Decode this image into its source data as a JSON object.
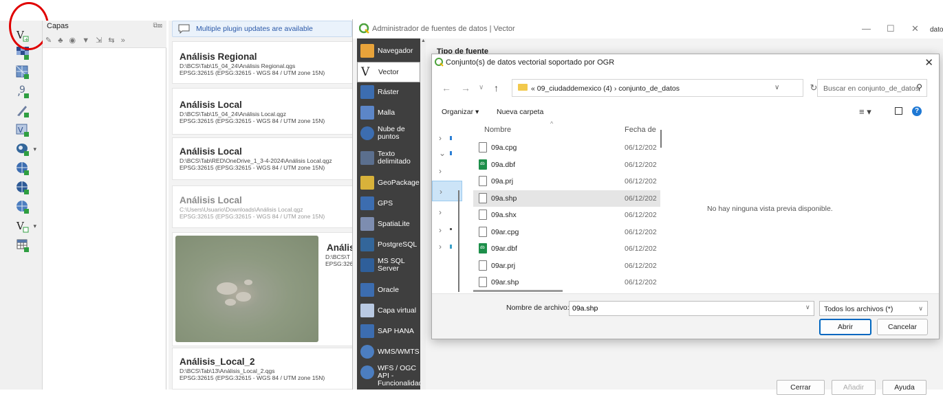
{
  "layers_panel": {
    "title": "Capas",
    "toolbar_glyphs": "✎ ♣ ◉ ▼ ⇲ ⇆ »"
  },
  "welcome": {
    "plugin_updates": "Multiple plugin updates are available",
    "projects": [
      {
        "title": "Análisis Regional",
        "path": "D:\\BCS\\Tab\\15_04_24\\Análisis Regional.qgs",
        "crs": "EPSG:32615 (EPSG:32615 - WGS 84 / UTM zone 15N)"
      },
      {
        "title": "Análisis Local",
        "path": "D:\\BCS\\Tab\\15_04_24\\Análisis Local.qgz",
        "crs": "EPSG:32615 (EPSG:32615 - WGS 84 / UTM zone 15N)"
      },
      {
        "title": "Análisis Local",
        "path": "D:\\BCS\\Tab\\RED\\OneDrive_1_3-4-2024\\Análisis Local.qgz",
        "crs": "EPSG:32615 (EPSG:32615 - WGS 84 / UTM zone 15N)"
      },
      {
        "title": "Análisis Local",
        "path": "C:\\Users\\Usuario\\Downloads\\Análisis Local.qgz",
        "crs": "EPSG:32615 (EPSG:32615 - WGS 84 / UTM zone 15N)"
      },
      {
        "title": "Análisi",
        "path": "D:\\BCS\\T",
        "crs": "EPSG:326"
      },
      {
        "title": "Análisis_Local_2",
        "path": "D:\\BCS\\Tab\\13\\Análisis_Local_2.qgs",
        "crs": "EPSG:32615 (EPSG:32615 - WGS 84 / UTM zone 15N)"
      }
    ]
  },
  "source_manager": {
    "title": "Administrador de fuentes de datos | Vector",
    "section_label": "Tipo de fuente",
    "nav": [
      {
        "label": "Navegador",
        "icon": "folder-icon"
      },
      {
        "label": "Vector",
        "icon": "vector-icon"
      },
      {
        "label": "Ráster",
        "icon": "raster-icon"
      },
      {
        "label": "Malla",
        "icon": "mesh-icon"
      },
      {
        "label": "Nube de puntos",
        "icon": "point-cloud-icon"
      },
      {
        "label": "Texto delimitado",
        "icon": "delimited-text-icon"
      },
      {
        "label": "GeoPackage",
        "icon": "geopackage-icon"
      },
      {
        "label": "GPS",
        "icon": "gps-icon"
      },
      {
        "label": "SpatiaLite",
        "icon": "spatialite-icon"
      },
      {
        "label": "PostgreSQL",
        "icon": "postgresql-icon"
      },
      {
        "label": "MS SQL Server",
        "icon": "mssql-icon"
      },
      {
        "label": "Oracle",
        "icon": "oracle-icon"
      },
      {
        "label": "Capa virtual",
        "icon": "virtual-layer-icon"
      },
      {
        "label": "SAP HANA",
        "icon": "sap-hana-icon"
      },
      {
        "label": "WMS/WMTS",
        "icon": "wms-icon"
      },
      {
        "label": "WFS / OGC API - Funcionalidad",
        "icon": "wfs-icon"
      }
    ],
    "buttons": {
      "close": "Cerrar",
      "add": "Añadir",
      "help": "Ayuda"
    },
    "minimize": "—",
    "maximize": "☐",
    "close_glyph": "✕"
  },
  "file_dialog": {
    "title": "Conjunto(s) de datos vectorial soportado por OGR",
    "breadcrumb": "« 09_ciudaddemexico (4)  ›  conjunto_de_datos",
    "search_placeholder": "Buscar en conjunto_de_datos",
    "organize": "Organizar ▾",
    "new_folder": "Nueva carpeta",
    "columns": {
      "name": "Nombre",
      "date": "Fecha de"
    },
    "files": [
      {
        "name": "09a.cpg",
        "date": "06/12/202",
        "type": "generic"
      },
      {
        "name": "09a.dbf",
        "date": "06/12/202",
        "type": "dbf"
      },
      {
        "name": "09a.prj",
        "date": "06/12/202",
        "type": "generic"
      },
      {
        "name": "09a.shp",
        "date": "06/12/202",
        "type": "generic",
        "selected": true
      },
      {
        "name": "09a.shx",
        "date": "06/12/202",
        "type": "generic"
      },
      {
        "name": "09ar.cpg",
        "date": "06/12/202",
        "type": "generic"
      },
      {
        "name": "09ar.dbf",
        "date": "06/12/202",
        "type": "dbf"
      },
      {
        "name": "09ar.prj",
        "date": "06/12/202",
        "type": "generic"
      },
      {
        "name": "09ar.shp",
        "date": "06/12/202",
        "type": "generic"
      }
    ],
    "preview_message": "No hay ninguna vista previa disponible.",
    "filename_label": "Nombre de archivo:",
    "filename_value": "09a.shp",
    "filter_value": "Todos los archivos (*)",
    "open": "Abrir",
    "cancel": "Cancelar"
  },
  "edge_fragment": "dato",
  "colors": {
    "accent": "#0067c0",
    "nav_bg": "#3f3f3f",
    "highlight_circle": "#e00000"
  }
}
